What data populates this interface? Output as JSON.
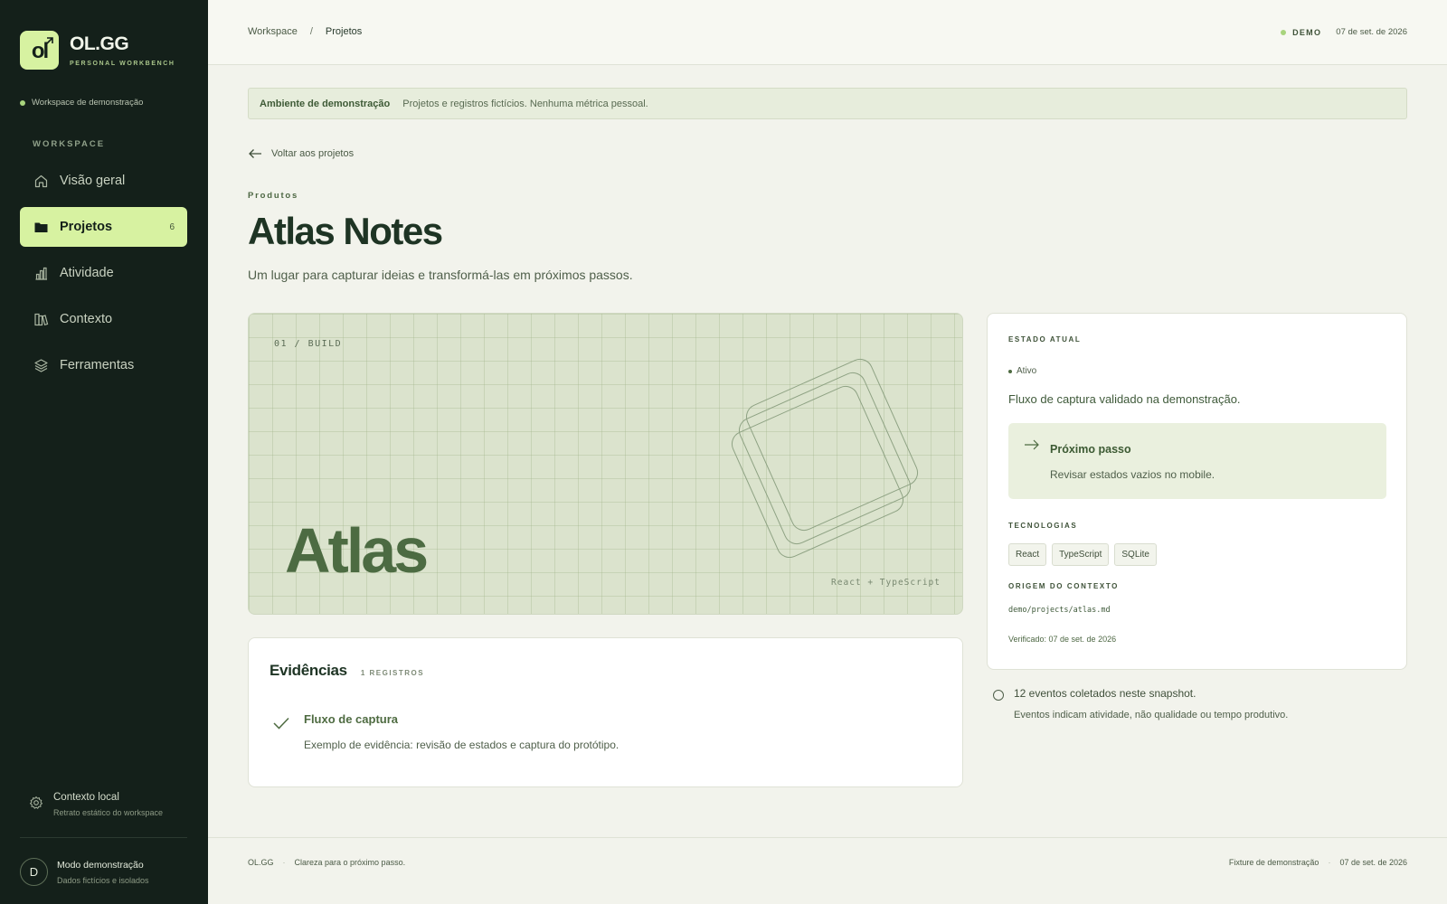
{
  "brand": {
    "mark": "ol",
    "name": "OL.GG",
    "subtitle": "PERSONAL WORKBENCH"
  },
  "workspace_status": "Workspace de demonstração",
  "sidebar": {
    "section_label": "WORKSPACE",
    "items": [
      {
        "label": "Visão geral",
        "icon": "home-icon"
      },
      {
        "label": "Projetos",
        "icon": "folder-icon",
        "count": "6",
        "active": true
      },
      {
        "label": "Atividade",
        "icon": "bar-chart-icon"
      },
      {
        "label": "Contexto",
        "icon": "books-icon"
      },
      {
        "label": "Ferramentas",
        "icon": "layers-icon"
      }
    ],
    "context": {
      "title": "Contexto local",
      "subtitle": "Retrato estático do workspace"
    },
    "user": {
      "initial": "D",
      "title": "Modo demonstração",
      "subtitle": "Dados fictícios e isolados"
    }
  },
  "topbar": {
    "breadcrumb": [
      "Workspace",
      "Projetos"
    ],
    "breadcrumb_sep": "/",
    "badge": "DEMO",
    "date": "07 de set. de 2026"
  },
  "banner": {
    "title": "Ambiente de demonstração",
    "text": "Projetos e registros fictícios. Nenhuma métrica pessoal."
  },
  "back_label": "Voltar aos projetos",
  "project": {
    "category": "Produtos",
    "title": "Atlas Notes",
    "description": "Um lugar para capturar ideias e transformá-las em próximos passos.",
    "hero": {
      "step": "01 / BUILD",
      "word": "Atlas",
      "stack": "React + TypeScript"
    }
  },
  "evidence": {
    "title": "Evidências",
    "count": "1 REGISTROS",
    "items": [
      {
        "title": "Fluxo de captura",
        "text": "Exemplo de evidência: revisão de estados e captura do protótipo."
      }
    ]
  },
  "state": {
    "label": "ESTADO ATUAL",
    "status": "Ativo",
    "summary": "Fluxo de captura validado na demonstração.",
    "next": {
      "title": "Próximo passo",
      "text": "Revisar estados vazios no mobile."
    },
    "tech_label": "TECNOLOGIAS",
    "technologies": [
      "React",
      "TypeScript",
      "SQLite"
    ],
    "origin_label": "ORIGEM DO CONTEXTO",
    "origin_path": "demo/projects/atlas.md",
    "verified": "Verificado: 07 de set. de 2026"
  },
  "events": {
    "title": "12 eventos coletados neste snapshot.",
    "note": "Eventos indicam atividade, não qualidade ou tempo produtivo."
  },
  "footer": {
    "brand": "OL.GG",
    "tagline": "Clareza para o próximo passo.",
    "fixture": "Fixture de demonstração",
    "date": "07 de set. de 2026",
    "sep": "·"
  },
  "colors": {
    "sidebar_bg": "#14201a",
    "accent": "#d7f2a1",
    "page_bg": "#f2f3ec",
    "hero_bg": "#dbe3cd",
    "heading": "#1e3424"
  }
}
